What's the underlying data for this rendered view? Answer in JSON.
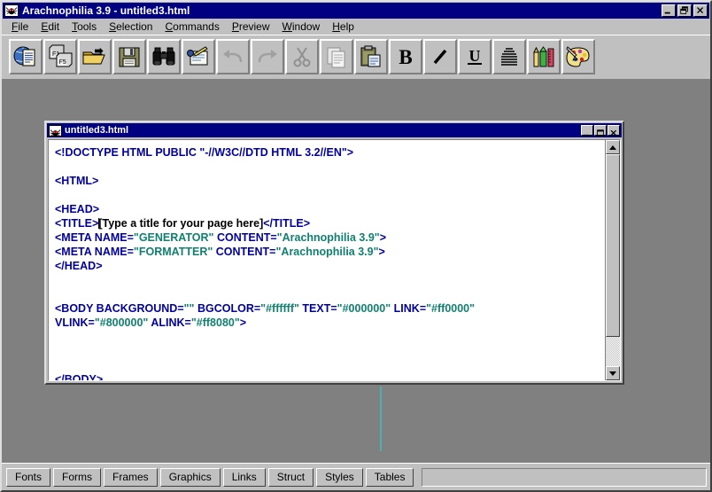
{
  "window": {
    "title": "Arachnophilia 3.9 - untitled3.html",
    "icon": "spider-app-icon",
    "controls": [
      {
        "name": "minimize-button",
        "glyph": "minimize"
      },
      {
        "name": "restore-button",
        "glyph": "restore"
      },
      {
        "name": "close-button",
        "glyph": "close"
      }
    ]
  },
  "menubar": {
    "items": [
      {
        "label": "File",
        "accel": "F"
      },
      {
        "label": "Edit",
        "accel": "E"
      },
      {
        "label": "Tools",
        "accel": "T"
      },
      {
        "label": "Selection",
        "accel": "S"
      },
      {
        "label": "Commands",
        "accel": "C"
      },
      {
        "label": "Preview",
        "accel": "P"
      },
      {
        "label": "Window",
        "accel": "W"
      },
      {
        "label": "Help",
        "accel": "H"
      }
    ]
  },
  "toolbar": {
    "buttons": [
      {
        "name": "new-html-page-button",
        "icon": "globe-document-icon",
        "enabled": true
      },
      {
        "name": "function-keys-button",
        "icon": "fkeys-icon",
        "enabled": true
      },
      {
        "name": "open-file-button",
        "icon": "open-folder-icon",
        "enabled": true
      },
      {
        "name": "save-file-button",
        "icon": "floppy-disk-icon",
        "enabled": true
      },
      {
        "name": "find-button",
        "icon": "binoculars-icon",
        "enabled": true
      },
      {
        "name": "replace-button",
        "icon": "notepad-pen-icon",
        "enabled": true
      },
      {
        "name": "undo-button",
        "icon": "undo-arrow-icon",
        "enabled": false
      },
      {
        "name": "redo-button",
        "icon": "redo-arrow-icon",
        "enabled": false
      },
      {
        "name": "cut-button",
        "icon": "scissors-icon",
        "enabled": false
      },
      {
        "name": "copy-button",
        "icon": "copy-pages-icon",
        "enabled": false
      },
      {
        "name": "paste-button",
        "icon": "clipboard-paste-icon",
        "enabled": true
      },
      {
        "name": "bold-button",
        "icon": "bold-icon",
        "label": "B",
        "enabled": true
      },
      {
        "name": "italic-button",
        "icon": "italic-icon",
        "label": "I",
        "enabled": true
      },
      {
        "name": "underline-button",
        "icon": "underline-icon",
        "label": "U",
        "enabled": true
      },
      {
        "name": "align-button",
        "icon": "align-lines-icon",
        "enabled": true
      },
      {
        "name": "tools-button",
        "icon": "pencil-ruler-icon",
        "enabled": true
      },
      {
        "name": "colors-button",
        "icon": "paint-palette-icon",
        "enabled": true
      }
    ]
  },
  "child_window": {
    "title": "untitled3.html",
    "icon": "spider-doc-icon",
    "controls": [
      {
        "name": "child-minimize-button",
        "glyph": "minimize"
      },
      {
        "name": "child-maximize-button",
        "glyph": "maximize"
      },
      {
        "name": "child-close-button",
        "glyph": "close"
      }
    ],
    "scrollbar": {
      "up_arrow": "scroll-up-arrow",
      "down_arrow": "scroll-down-arrow",
      "thumb_percent": 86
    }
  },
  "editor": {
    "lines": [
      {
        "segments": [
          {
            "t": "tag",
            "s": "<!DOCTYPE HTML PUBLIC \"-//W3C//DTD HTML 3.2//EN\">"
          }
        ]
      },
      {
        "segments": []
      },
      {
        "segments": [
          {
            "t": "tag",
            "s": "<HTML>"
          }
        ]
      },
      {
        "segments": []
      },
      {
        "segments": [
          {
            "t": "tag",
            "s": "<HEAD>"
          }
        ]
      },
      {
        "segments": [
          {
            "t": "tag",
            "s": "<TITLE>"
          },
          {
            "t": "caret",
            "s": ""
          },
          {
            "t": "txt",
            "s": "[Type a title for your page here]"
          },
          {
            "t": "tag",
            "s": "</TITLE>"
          }
        ]
      },
      {
        "segments": [
          {
            "t": "tag",
            "s": "<META NAME="
          },
          {
            "t": "val",
            "s": "\"GENERATOR\""
          },
          {
            "t": "tag",
            "s": " CONTENT="
          },
          {
            "t": "val",
            "s": "\"Arachnophilia 3.9\""
          },
          {
            "t": "tag",
            "s": ">"
          }
        ]
      },
      {
        "segments": [
          {
            "t": "tag",
            "s": "<META NAME="
          },
          {
            "t": "val",
            "s": "\"FORMATTER\""
          },
          {
            "t": "tag",
            "s": " CONTENT="
          },
          {
            "t": "val",
            "s": "\"Arachnophilia 3.9\""
          },
          {
            "t": "tag",
            "s": ">"
          }
        ]
      },
      {
        "segments": [
          {
            "t": "tag",
            "s": "</HEAD>"
          }
        ]
      },
      {
        "segments": []
      },
      {
        "segments": []
      },
      {
        "segments": [
          {
            "t": "tag",
            "s": "<BODY BACKGROUND="
          },
          {
            "t": "val",
            "s": "\"\""
          },
          {
            "t": "tag",
            "s": " BGCOLOR="
          },
          {
            "t": "val",
            "s": "\"#ffffff\""
          },
          {
            "t": "tag",
            "s": " TEXT="
          },
          {
            "t": "val",
            "s": "\"#000000\""
          },
          {
            "t": "tag",
            "s": " LINK="
          },
          {
            "t": "val",
            "s": "\"#ff0000\""
          }
        ]
      },
      {
        "segments": [
          {
            "t": "tag",
            "s": "VLINK="
          },
          {
            "t": "val",
            "s": "\"#800000\""
          },
          {
            "t": "tag",
            "s": " ALINK="
          },
          {
            "t": "val",
            "s": "\"#ff8080\""
          },
          {
            "t": "tag",
            "s": ">"
          }
        ]
      },
      {
        "segments": []
      },
      {
        "segments": []
      },
      {
        "segments": []
      },
      {
        "segments": [
          {
            "t": "tag",
            "s": "</BODY>"
          }
        ]
      }
    ],
    "colors": {
      "tag": "#0000a0",
      "value": "#108070",
      "text": "#000000",
      "background": "#ffffff"
    }
  },
  "bottom_tabs": {
    "items": [
      {
        "label": "Fonts",
        "name": "tab-fonts"
      },
      {
        "label": "Forms",
        "name": "tab-forms"
      },
      {
        "label": "Frames",
        "name": "tab-frames"
      },
      {
        "label": "Graphics",
        "name": "tab-graphics"
      },
      {
        "label": "Links",
        "name": "tab-links"
      },
      {
        "label": "Struct",
        "name": "tab-struct"
      },
      {
        "label": "Styles",
        "name": "tab-styles"
      },
      {
        "label": "Tables",
        "name": "tab-tables"
      }
    ]
  },
  "theme": {
    "face": "#c0c0c0",
    "titlebar_active": "#000080",
    "mdi_background": "#808080",
    "drag_line": "#4ab0b0"
  }
}
